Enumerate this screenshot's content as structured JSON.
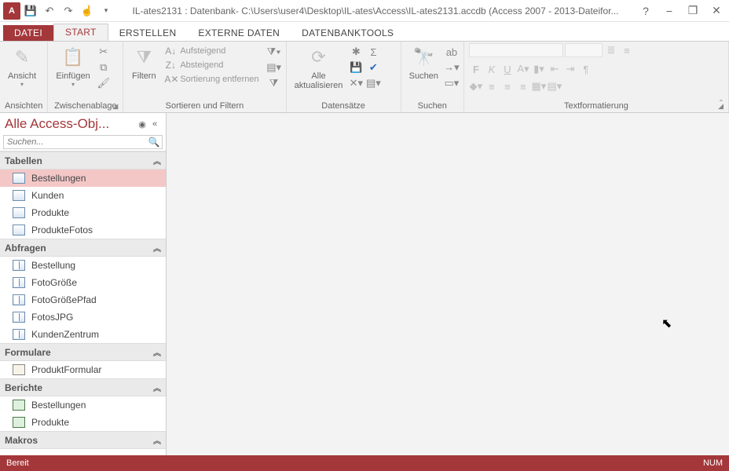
{
  "titlebar": {
    "title": "IL-ates2131 : Datenbank- C:\\Users\\user4\\Desktop\\IL-ates\\Access\\IL-ates2131.accdb (Access 2007 - 2013-Dateifor..."
  },
  "tabs": {
    "file": "DATEI",
    "items": [
      "START",
      "ERSTELLEN",
      "EXTERNE DATEN",
      "DATENBANKTOOLS"
    ],
    "activeIndex": 0
  },
  "ribbon": {
    "groups": {
      "ansichten": {
        "label": "Ansichten",
        "ansicht": "Ansicht"
      },
      "clipboard": {
        "label": "Zwischenablage",
        "paste": "Einfügen"
      },
      "sortfilter": {
        "label": "Sortieren und Filtern",
        "filter": "Filtern",
        "asc": "Aufsteigend",
        "desc": "Absteigend",
        "clear": "Sortierung entfernen"
      },
      "records": {
        "label": "Datensätze",
        "refresh": "Alle\naktualisieren"
      },
      "find": {
        "label": "Suchen",
        "find": "Suchen"
      },
      "textfmt": {
        "label": "Textformatierung"
      }
    }
  },
  "nav": {
    "title": "Alle Access-Obj...",
    "searchPlaceholder": "Suchen...",
    "groups": [
      {
        "name": "Tabellen",
        "type": "table",
        "items": [
          "Bestellungen",
          "Kunden",
          "Produkte",
          "ProdukteFotos"
        ],
        "selectedIndex": 0
      },
      {
        "name": "Abfragen",
        "type": "query",
        "items": [
          "Bestellung",
          "FotoGröße",
          "FotoGrößePfad",
          "FotosJPG",
          "KundenZentrum"
        ]
      },
      {
        "name": "Formulare",
        "type": "form",
        "items": [
          "ProduktFormular"
        ]
      },
      {
        "name": "Berichte",
        "type": "report",
        "items": [
          "Bestellungen",
          "Produkte"
        ]
      },
      {
        "name": "Makros",
        "type": "macro",
        "items": []
      }
    ]
  },
  "statusbar": {
    "left": "Bereit",
    "right": "NUM"
  }
}
